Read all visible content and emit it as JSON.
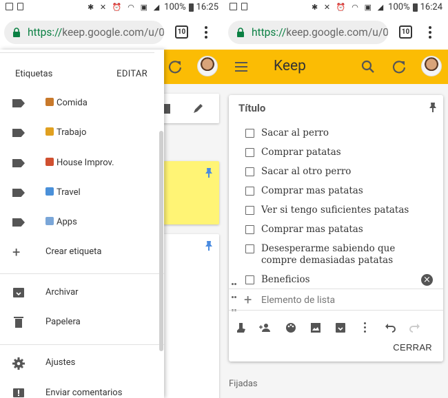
{
  "left": {
    "status": {
      "battery": "100%",
      "time": "16:25"
    },
    "url": {
      "scheme": "https://",
      "host": "keep.google.com/u/0."
    },
    "tab_count": "10",
    "drawer": {
      "section_label": "Etiquetas",
      "edit_label": "EDITAR",
      "labels": [
        {
          "emoji_color": "#c8792b",
          "text": "Comida"
        },
        {
          "emoji_color": "#e0a020",
          "text": "Trabajo"
        },
        {
          "emoji_color": "#d05030",
          "text": "House Improv."
        },
        {
          "emoji_color": "#4a90d9",
          "text": "Travel"
        },
        {
          "emoji_color": "#7aa6d8",
          "text": "Apps"
        }
      ],
      "create_label": "Crear etiqueta",
      "archive_label": "Archivar",
      "trash_label": "Papelera",
      "settings_label": "Ajustes",
      "feedback_label": "Enviar comentarios"
    },
    "pinned_card_color": "#fff475"
  },
  "right": {
    "status": {
      "battery": "100%",
      "time": "16:24"
    },
    "url": {
      "scheme": "https://",
      "host": "keep.google.com/u/0."
    },
    "tab_count": "10",
    "app_title": "Keep",
    "note": {
      "title": "Título",
      "items": [
        "Sacar al perro",
        "Comprar patatas",
        "Sacar al otro perro",
        "Comprar mas patatas",
        "Ver si tengo suficientes patatas",
        "Comprar mas patatas",
        "Desesperarme sabiendo que compre demasiadas patatas",
        "Beneficios"
      ],
      "add_placeholder": "Elemento de lista",
      "close_label": "CERRAR"
    },
    "section_pinned": "Fijadas",
    "accent": "#fbbc04",
    "pin_color": "#4a8be0"
  }
}
